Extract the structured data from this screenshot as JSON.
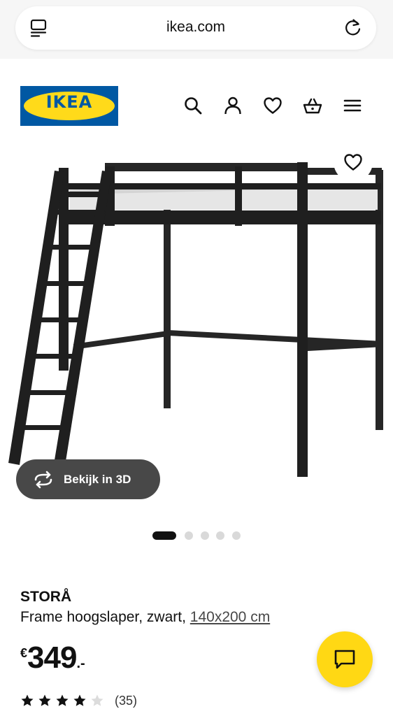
{
  "browser": {
    "url": "ikea.com",
    "tabs_icon": "tabs-icon",
    "reload_icon": "reload-icon"
  },
  "header": {
    "logo_text": "IKEA",
    "icons": [
      "search-icon",
      "account-icon",
      "favorites-icon",
      "cart-icon",
      "menu-icon"
    ]
  },
  "gallery": {
    "favorite_icon": "heart-icon",
    "view_3d_label": "Bekijk in 3D",
    "image_count": 5,
    "active_index": 0
  },
  "product": {
    "name": "STORÅ",
    "description": "Frame hoogslaper, zwart, ",
    "size_link": "140x200 cm",
    "price": {
      "currency": "€",
      "amount": "349",
      "suffix": ".-"
    },
    "rating": {
      "value": 4,
      "max": 5,
      "count_text": "(35)"
    }
  },
  "chat": {
    "icon": "chat-icon"
  },
  "colors": {
    "ikea_blue": "#0058a3",
    "ikea_yellow": "#ffda1a",
    "chat_yellow": "#ffd814",
    "view3d_bg": "#484848"
  }
}
